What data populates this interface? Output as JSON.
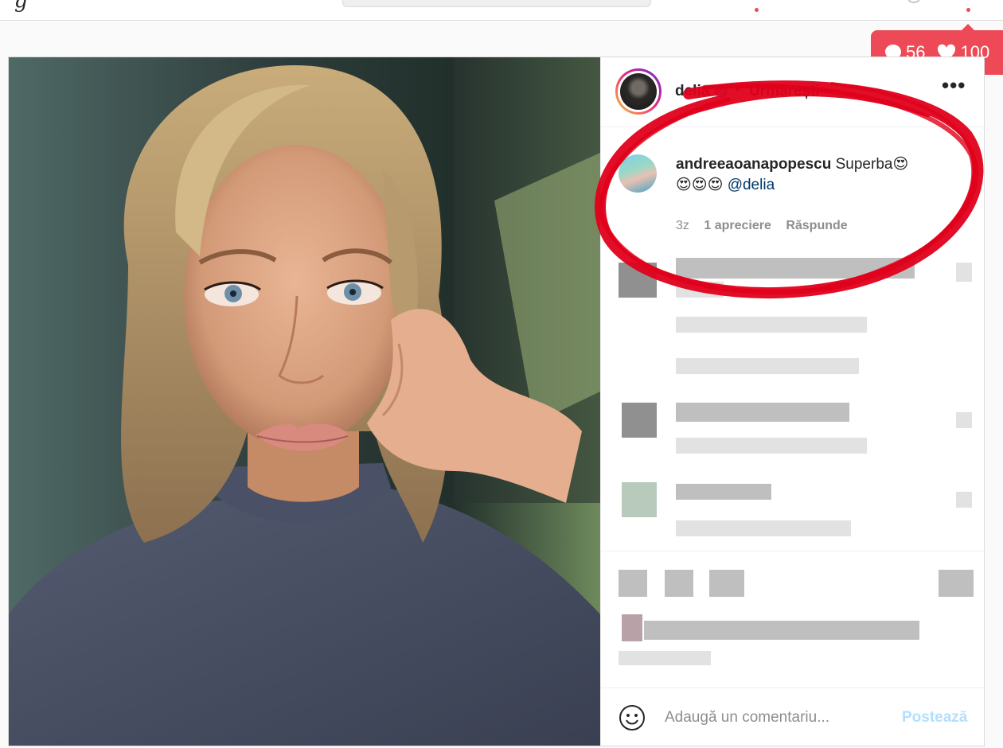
{
  "nav": {
    "logo_fragment": "g"
  },
  "activity": {
    "comments": "56",
    "likes": "100"
  },
  "post": {
    "author": {
      "username": "delia",
      "verified": true,
      "bullet": "•",
      "follow_status": "Urmărești"
    },
    "more_icon": "ellipsis-icon",
    "highlighted_comment": {
      "username": "andreeaoanapopescu",
      "text": " Superba😍",
      "line2": "😍😍😍 ",
      "mention": "@delia",
      "age": "3z",
      "likes": "1 apreciere",
      "reply": "Răspunde"
    },
    "add_comment": {
      "placeholder": "Adaugă un comentariu...",
      "post_label": "Postează"
    }
  },
  "colors": {
    "accent_red": "#ed4956",
    "link_blue": "#00376b",
    "disabled_blue": "#b2dffc",
    "verified_blue": "#3897f0",
    "annotation_red": "#e0001a"
  }
}
